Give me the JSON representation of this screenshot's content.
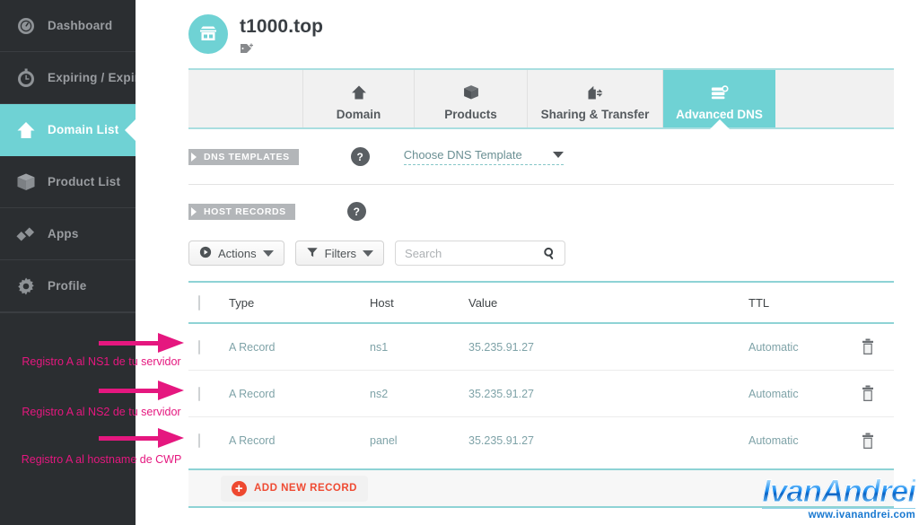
{
  "sidebar": {
    "items": [
      {
        "label": "Dashboard",
        "icon": "gauge-icon",
        "active": false
      },
      {
        "label": "Expiring / Expired",
        "icon": "clock-icon",
        "active": false
      },
      {
        "label": "Domain List",
        "icon": "home-icon",
        "active": true
      },
      {
        "label": "Product List",
        "icon": "box-icon",
        "active": false
      },
      {
        "label": "Apps",
        "icon": "diamonds-icon",
        "active": false
      },
      {
        "label": "Profile",
        "icon": "gear-icon",
        "active": false
      }
    ]
  },
  "annotations": [
    {
      "text": "Registro A al NS1 de tu servidor",
      "color": "#e5177f"
    },
    {
      "text": "Registro A al NS2 de tu servidor",
      "color": "#e5177f"
    },
    {
      "text": "Registro A al hostname de CWP",
      "color": "#e5177f"
    }
  ],
  "domain": {
    "title": "t1000.top",
    "avatar_icon": "store-icon",
    "tag_icon": "add-tag-icon"
  },
  "tabs": [
    {
      "label": "Domain",
      "icon": "home-icon",
      "active": false
    },
    {
      "label": "Products",
      "icon": "box-icon",
      "active": false
    },
    {
      "label": "Sharing & Transfer",
      "icon": "share-icon",
      "active": false
    },
    {
      "label": "Advanced DNS",
      "icon": "dns-server-icon",
      "active": true
    }
  ],
  "sections": {
    "dns_templates": {
      "label": "DNS TEMPLATES",
      "help": "?",
      "select_value": "Choose DNS Template",
      "caret_icon": "chevron-down-icon"
    },
    "host_records": {
      "label": "HOST RECORDS",
      "help": "?"
    }
  },
  "toolbar": {
    "actions_label": "Actions",
    "actions_icon": "play-circle-icon",
    "filters_label": "Filters",
    "filters_icon": "funnel-icon",
    "search_placeholder": "Search",
    "search_value": "",
    "search_icon": "search-icon",
    "caret_icon": "chevron-down-icon"
  },
  "table": {
    "columns": [
      "Type",
      "Host",
      "Value",
      "TTL"
    ],
    "rows": [
      {
        "type": "A Record",
        "host": "ns1",
        "value": "35.235.91.27",
        "ttl": "Automatic",
        "delete_icon": "trash-icon"
      },
      {
        "type": "A Record",
        "host": "ns2",
        "value": "35.235.91.27",
        "ttl": "Automatic",
        "delete_icon": "trash-icon"
      },
      {
        "type": "A Record",
        "host": "panel",
        "value": "35.235.91.27",
        "ttl": "Automatic",
        "delete_icon": "trash-icon"
      }
    ]
  },
  "footer": {
    "add_label": "ADD NEW RECORD",
    "add_icon": "plus-circle-icon"
  },
  "watermark": {
    "name": "IvanAndrei",
    "url": "www.ivanandrei.com"
  },
  "colors": {
    "accent_teal": "#6fd2d4",
    "sidebar_dark": "#2b2e31",
    "annotation_pink": "#e5177f",
    "add_red": "#ee4930",
    "link_blue_gray": "#7fa3a8"
  }
}
